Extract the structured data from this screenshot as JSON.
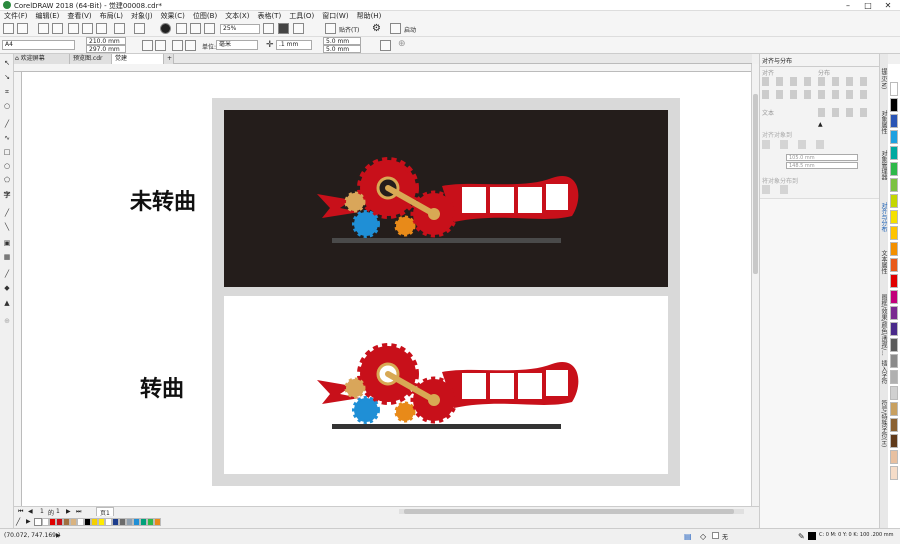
{
  "window": {
    "title": "CorelDRAW 2018 (64-Bit) - 觉建00008.cdr*"
  },
  "menu": [
    "文件(F)",
    "编辑(E)",
    "查看(V)",
    "布局(L)",
    "对象(J)",
    "效果(C)",
    "位图(B)",
    "文本(X)",
    "表格(T)",
    "工具(O)",
    "窗口(W)",
    "帮助(H)"
  ],
  "toolbar1": {
    "zoom": "25%",
    "snap_label": "贴齐(T)",
    "launch_label": "启动"
  },
  "toolbar2": {
    "page_size": "A4",
    "width": "210.0 mm",
    "height": "297.0 mm",
    "units_label": "单位:",
    "units_value": "毫米",
    "nudge": ".1 mm",
    "dup_x": "5.0 mm",
    "dup_y": "5.0 mm"
  },
  "tabs": [
    "欢迎屏幕",
    "预览图.cdr",
    "觉建00008.cdr*"
  ],
  "canvas": {
    "label_top": "未转曲",
    "label_bottom": "转曲"
  },
  "docker": {
    "title": "对齐与分布",
    "sections": [
      "对齐",
      "分布",
      "文本",
      "对齐对象到",
      "将对象分布到"
    ],
    "field_w": "105.0 mm",
    "field_h": "148.5 mm"
  },
  "docker_tabs": [
    "提示(N)",
    "对象属性",
    "对象管理器",
    "对齐与分布",
    "文本属性",
    "图框/效果/颜色/透视/...",
    "插入字符",
    "符号/特殊字符(H)"
  ],
  "page_nav": {
    "current": "1",
    "of": "的",
    "total": "1",
    "page_tab": "页1"
  },
  "status": {
    "coords": "(70.072, 747.169 )",
    "fill_label": "无",
    "color_info": "C: 0 M: 0 Y: 0 K: 100  .200 mm"
  },
  "colors": {
    "accent": "#c8101a",
    "canvas_dark": "#241d1b",
    "frame": "#d9d9d9",
    "blue_gear": "#1f8fd6",
    "orange_gear": "#e88a19",
    "tan_gear": "#d9a65a",
    "gold_bar": "#d8a954"
  },
  "palette_h": [
    "#ffffff",
    "#e00000",
    "#c8101a",
    "#a07040",
    "#d9b380",
    "#ffffff",
    "#000000",
    "#f5d000",
    "#ffec00",
    "#ffffff",
    "#1c3c8c",
    "#6b6b6b",
    "#8fa0b0",
    "#1f8fd6",
    "#00a07a",
    "#2eb84a",
    "#e88a19"
  ],
  "palette_v": [
    "#ffffff",
    "#000000",
    "#2a55b5",
    "#1ea0e0",
    "#00a9a0",
    "#2eb84a",
    "#7cc242",
    "#c4d600",
    "#f5e100",
    "#ffc400",
    "#f39000",
    "#e85a1a",
    "#e00000",
    "#c2007a",
    "#7a2a90",
    "#4a2a8a",
    "#5a5a5a",
    "#8a8a8a",
    "#b0b0b0",
    "#d0d0d0",
    "#c8a060",
    "#8a6030",
    "#603a1a",
    "#e8c0a0",
    "#f5dcc8"
  ]
}
